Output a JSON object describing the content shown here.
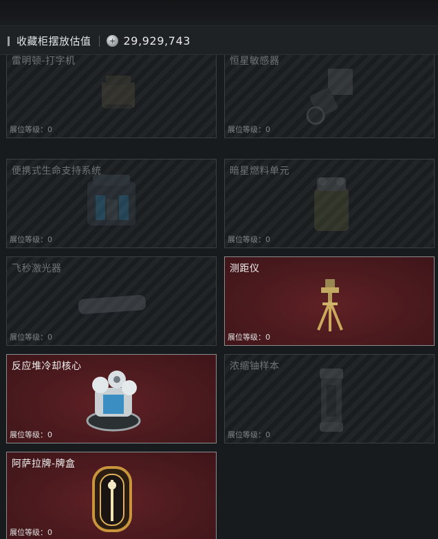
{
  "header": {
    "title": "收藏柜摆放估值",
    "value": "29,929,743",
    "currency_icon": "silver-coin-icon"
  },
  "level_prefix": "展位等级：",
  "cards": [
    {
      "name": "雷明顿-打字机",
      "level": "0",
      "active": false,
      "icon": "typewriter-icon"
    },
    {
      "name": "恒星敏感器",
      "level": "0",
      "active": false,
      "icon": "star-sensor-icon"
    },
    {
      "name": "便携式生命支持系统",
      "level": "0",
      "active": false,
      "icon": "life-support-icon"
    },
    {
      "name": "暗星燃料单元",
      "level": "0",
      "active": false,
      "icon": "fuel-cell-icon"
    },
    {
      "name": "飞秒激光器",
      "level": "0",
      "active": false,
      "icon": "laser-icon"
    },
    {
      "name": "测距仪",
      "level": "0",
      "active": true,
      "icon": "rangefinder-tripod-icon"
    },
    {
      "name": "反应堆冷却核心",
      "level": "0",
      "active": true,
      "icon": "reactor-core-icon"
    },
    {
      "name": "浓缩铀样本",
      "level": "0",
      "active": false,
      "icon": "uranium-canister-icon"
    },
    {
      "name": "阿萨拉牌-牌盒",
      "level": "0",
      "active": true,
      "icon": "card-box-icon"
    }
  ],
  "colors": {
    "active_card_bg": "#4b1a1e",
    "page_bg": "#1c2023"
  }
}
